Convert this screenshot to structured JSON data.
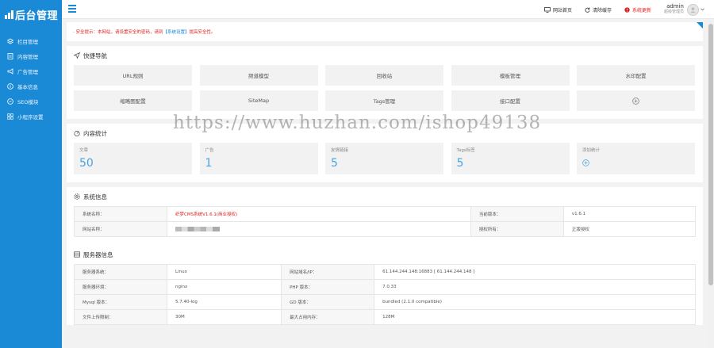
{
  "app": {
    "logo_text": "后台管理"
  },
  "sidebar": {
    "items": [
      {
        "label": "栏目管理",
        "icon": "layers-icon"
      },
      {
        "label": "内容管理",
        "icon": "document-icon"
      },
      {
        "label": "广告管理",
        "icon": "megaphone-icon"
      },
      {
        "label": "基本信息",
        "icon": "info-icon"
      },
      {
        "label": "SEO模块",
        "icon": "seo-icon"
      },
      {
        "label": "小程序设置",
        "icon": "grid-icon"
      }
    ]
  },
  "topbar": {
    "site_home": "网站首页",
    "clear_cache": "清除缓存",
    "system_update": "系统更新",
    "username": "admin",
    "role": "超级管理员"
  },
  "notice": {
    "text_before": "· 安全提示：本网站，请设置安全的密码，请到",
    "link": "【系统设置】",
    "text_after": "提高安全性。"
  },
  "quick_nav": {
    "title": "快捷导航",
    "items": [
      "URL规则",
      "频道模型",
      "回收站",
      "模板管理",
      "水印配置",
      "缩略图配置",
      "SiteMap",
      "Tags管理",
      "接口配置"
    ]
  },
  "content_stats": {
    "title": "内容统计",
    "items": [
      {
        "label": "文章",
        "value": "50"
      },
      {
        "label": "广告",
        "value": "1"
      },
      {
        "label": "友情链接",
        "value": "5"
      },
      {
        "label": "Tags标签",
        "value": "5"
      },
      {
        "label": "添加统计",
        "value": ""
      }
    ]
  },
  "system_info": {
    "title": "系统信息",
    "rows": [
      {
        "k1": "系统名称：",
        "v1": "织梦CMS系统V1.6.1(商业授权)",
        "k2": "当前版本：",
        "v2": "v1.6.1"
      },
      {
        "k1": "网站名称：",
        "v1": "",
        "k2": "授权所有：",
        "v2": "正版授权"
      }
    ]
  },
  "server_info": {
    "title": "服务器信息",
    "rows": [
      {
        "k1": "服务器系统：",
        "v1": "Linux",
        "k2": "网站域名/IP：",
        "v2": "61.144.244.148:16883 [ 61.144.244.148 ]"
      },
      {
        "k1": "服务器环境：",
        "v1": "nginx",
        "k2": "PHP 版本：",
        "v2": "7.0.33"
      },
      {
        "k1": "Mysql 版本：",
        "v1": "5.7.40-log",
        "k2": "GD 版本：",
        "v2": "bundled (2.1.0 compatible)"
      },
      {
        "k1": "文件上传限制：",
        "v1": "30M",
        "k2": "最大占用内存：",
        "v2": "128M"
      }
    ]
  },
  "watermark": "https://www.huzhan.com/ishop49138",
  "colors": {
    "sidebar": "#1a8ad6",
    "accent": "#4aa3e0",
    "danger": "#e02020"
  }
}
